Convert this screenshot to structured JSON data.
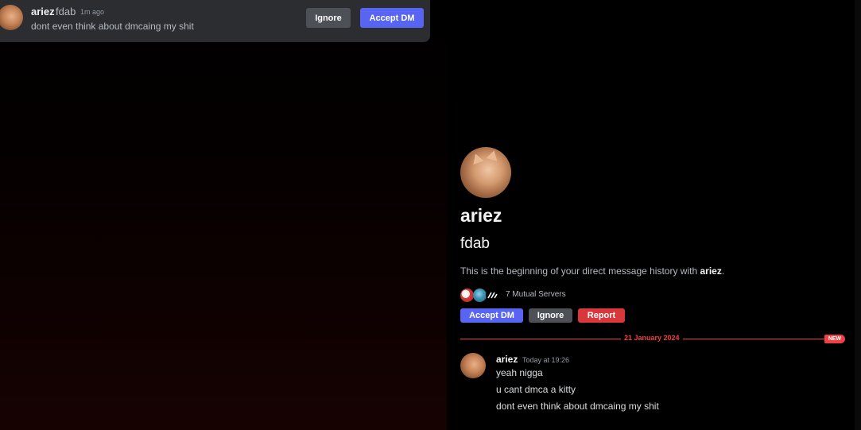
{
  "toast": {
    "name": "ariez",
    "handle": "fdab",
    "time": "1m ago",
    "message": "dont even think about dmcaing my shit",
    "ignore_label": "Ignore",
    "accept_label": "Accept DM"
  },
  "profile": {
    "name": "ariez",
    "handle": "fdab",
    "intro_prefix": "This is the beginning of your direct message history with ",
    "intro_name": "ariez",
    "intro_suffix": ".",
    "mutual_servers": "7 Mutual Servers",
    "accept_label": "Accept DM",
    "ignore_label": "Ignore",
    "report_label": "Report"
  },
  "divider": {
    "date": "21 January 2024",
    "badge": "NEW"
  },
  "message_group": {
    "author": "ariez",
    "timestamp": "Today at 19:26",
    "lines": [
      "yeah nigga",
      "u cant dmca a kitty",
      "dont even think about dmcaing my shit"
    ]
  },
  "colors": {
    "blurple": "#5865f2",
    "danger": "#da373c",
    "new_marker": "#f23f43"
  }
}
